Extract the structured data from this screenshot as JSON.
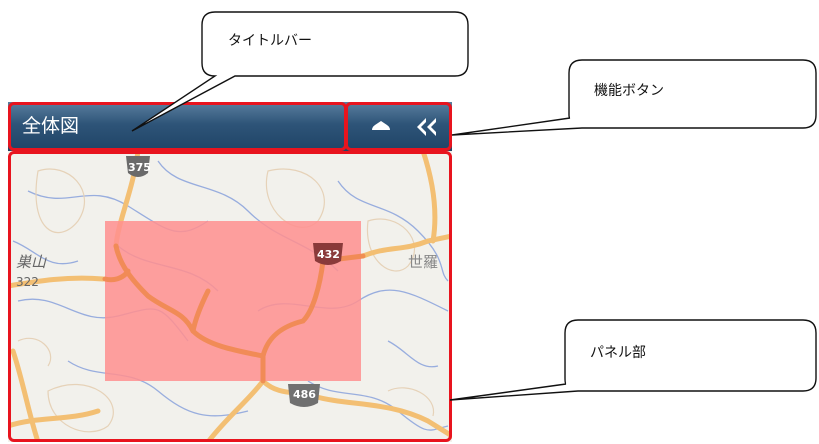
{
  "panel": {
    "title": "全体図",
    "buttons": [
      {
        "name": "up",
        "icon": "triangle-up-icon"
      },
      {
        "name": "collapse",
        "icon": "double-chevron-left-icon"
      }
    ]
  },
  "map": {
    "route_labels": [
      "375",
      "432",
      "486"
    ],
    "place_labels": [
      "巣山",
      "322",
      "世羅"
    ],
    "highlight_color": "#ff8a8a"
  },
  "callouts": {
    "title_bar": "タイトルバー",
    "function_buttons": "機能ボタン",
    "panel_area": "パネル部"
  },
  "colors": {
    "frame": "#e8141e",
    "titlebar_top": "#5a7f9f",
    "titlebar_bottom": "#1f4466"
  }
}
